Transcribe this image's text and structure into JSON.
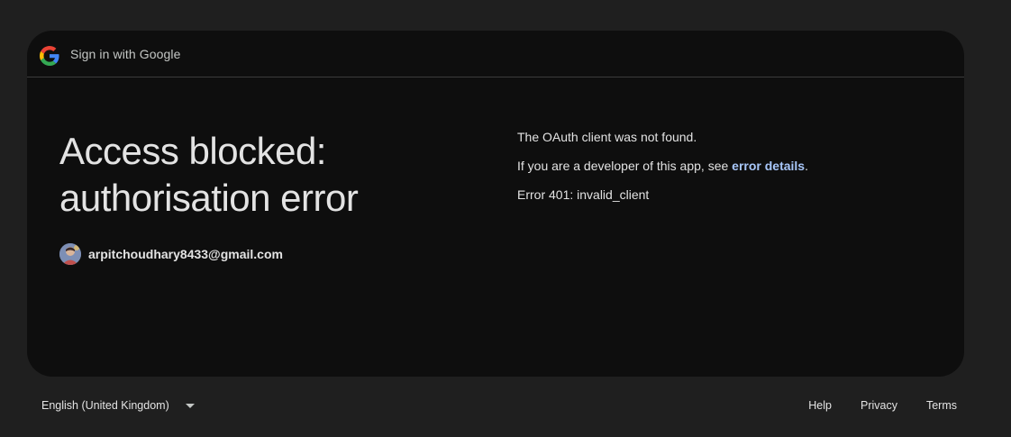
{
  "header": {
    "brand_text": "Sign in with Google",
    "logo_icon": "google-g-logo"
  },
  "main": {
    "title_line1": "Access blocked:",
    "title_line2": "authorisation error",
    "account_email": "arpitchoudhary8433@gmail.com",
    "message_not_found": "The OAuth client was not found.",
    "developer_prefix": "If you are a developer of this app, see ",
    "developer_link": "error details",
    "developer_suffix": ".",
    "error_code": "Error 401: invalid_client"
  },
  "footer": {
    "language": "English (United Kingdom)",
    "links": [
      "Help",
      "Privacy",
      "Terms"
    ]
  },
  "colors": {
    "background": "#1f1f1f",
    "card": "#0e0e0e",
    "link": "#a8c7fa",
    "text": "#e3e3e3"
  }
}
